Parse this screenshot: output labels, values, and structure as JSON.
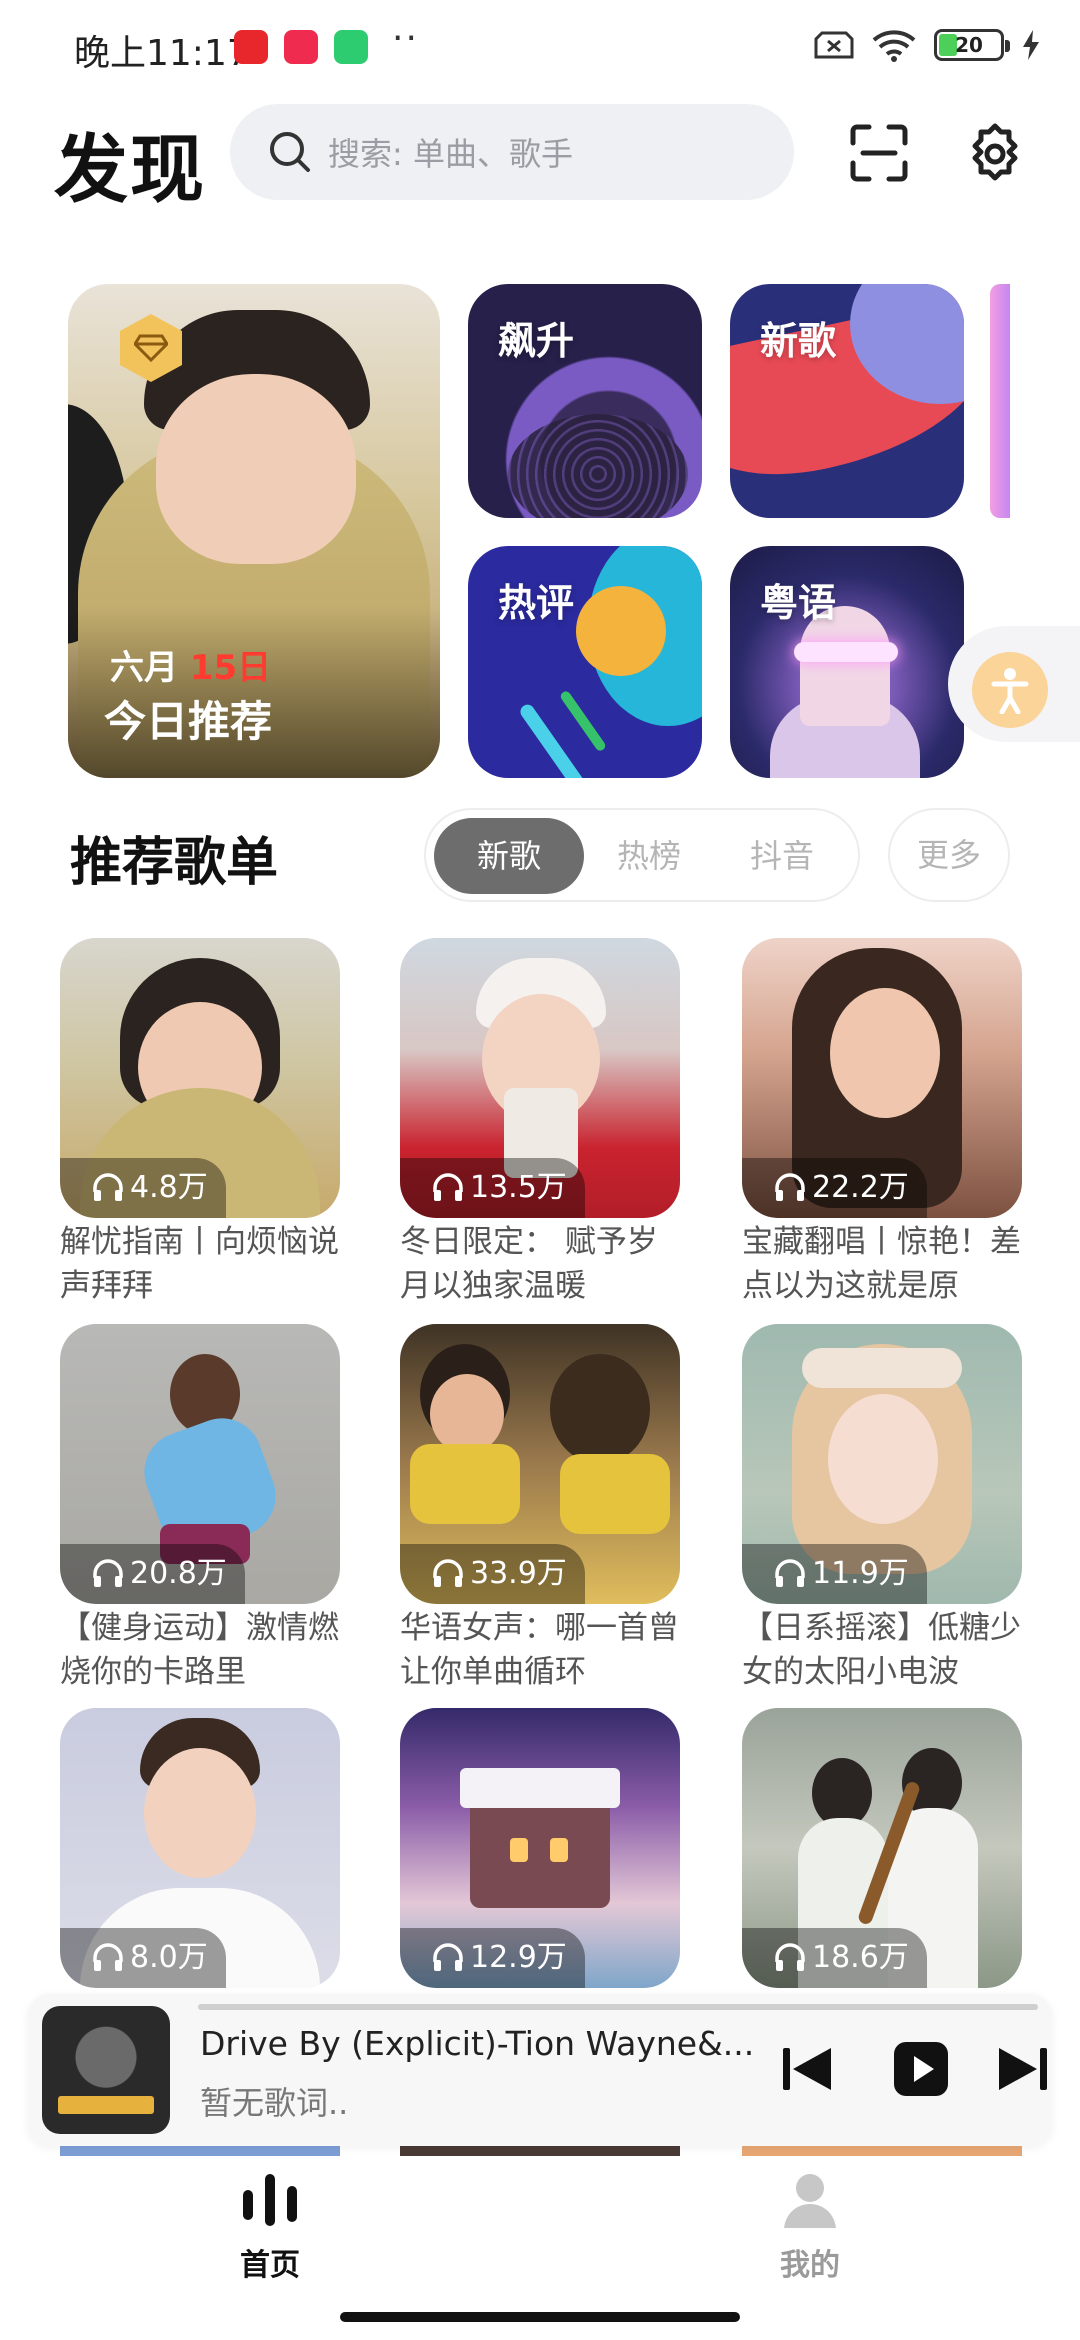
{
  "status_bar": {
    "time": "晚上11:17",
    "dots": "··",
    "battery": "20"
  },
  "header": {
    "title": "发现",
    "search_placeholder": "搜索: 单曲、歌手",
    "icons": [
      "search-icon",
      "scan-icon",
      "settings-gear-icon"
    ]
  },
  "features": {
    "daily": {
      "month": "六月",
      "day": "15日",
      "title": "今日推荐"
    },
    "tiles": [
      {
        "label": "飙升"
      },
      {
        "label": "新歌"
      },
      {
        "label": "热评"
      },
      {
        "label": "粤语"
      }
    ]
  },
  "section": {
    "title": "推荐歌单",
    "tabs": [
      {
        "label": "新歌",
        "active": true
      },
      {
        "label": "热榜",
        "active": false
      },
      {
        "label": "抖音",
        "active": false
      }
    ],
    "more": "更多"
  },
  "playlists": [
    {
      "plays": "4.8万",
      "title": "解忧指南丨向烦恼说声拜拜"
    },
    {
      "plays": "13.5万",
      "title": "冬日限定： 赋予岁月以独家温暖"
    },
    {
      "plays": "22.2万",
      "title": "宝藏翻唱丨惊艳！差点以为这就是原"
    },
    {
      "plays": "20.8万",
      "title": "【健身运动】激情燃烧你的卡路里"
    },
    {
      "plays": "33.9万",
      "title": "华语女声：哪一首曾让你单曲循环"
    },
    {
      "plays": "11.9万",
      "title": "【日系摇滚】低糖少女的太阳小电波"
    },
    {
      "plays": "8.0万",
      "title": ""
    },
    {
      "plays": "12.9万",
      "title": ""
    },
    {
      "plays": "18.6万",
      "title": ""
    }
  ],
  "player": {
    "song": "Drive By (Explicit)-Tion Wayne&...",
    "lyrics": "暂无歌词..",
    "controls": [
      "previous-icon",
      "play-icon",
      "next-icon"
    ]
  },
  "bottom_nav": [
    {
      "label": "首页",
      "active": true,
      "icon": "home-waveform-icon"
    },
    {
      "label": "我的",
      "active": false,
      "icon": "profile-icon"
    }
  ],
  "colors": {
    "date_accent": "#ff3b30",
    "active_tab_bg": "#6d6d6d",
    "inactive_text": "#b5b5b5"
  }
}
